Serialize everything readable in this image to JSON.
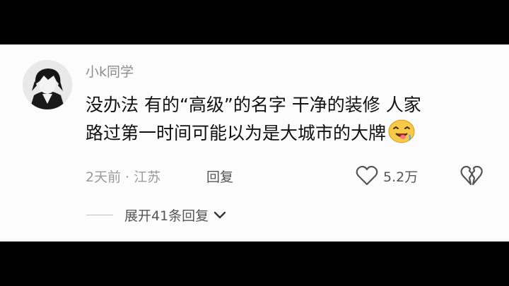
{
  "comment": {
    "username": "小k同学",
    "line1": "没办法 有的“高级”的名字 干净的装修 人家",
    "line2": "路过第一时间可能以为是大城市的大牌",
    "emoji": "drooling-face-emoji",
    "meta": "2天前 · 江苏",
    "reply_label": "回复",
    "like_count": "5.2万",
    "expand_label": "展开41条回复"
  },
  "icons": {
    "like": "heart-outline-icon",
    "dislike": "broken-heart-icon",
    "expand": "chevron-down-icon"
  }
}
